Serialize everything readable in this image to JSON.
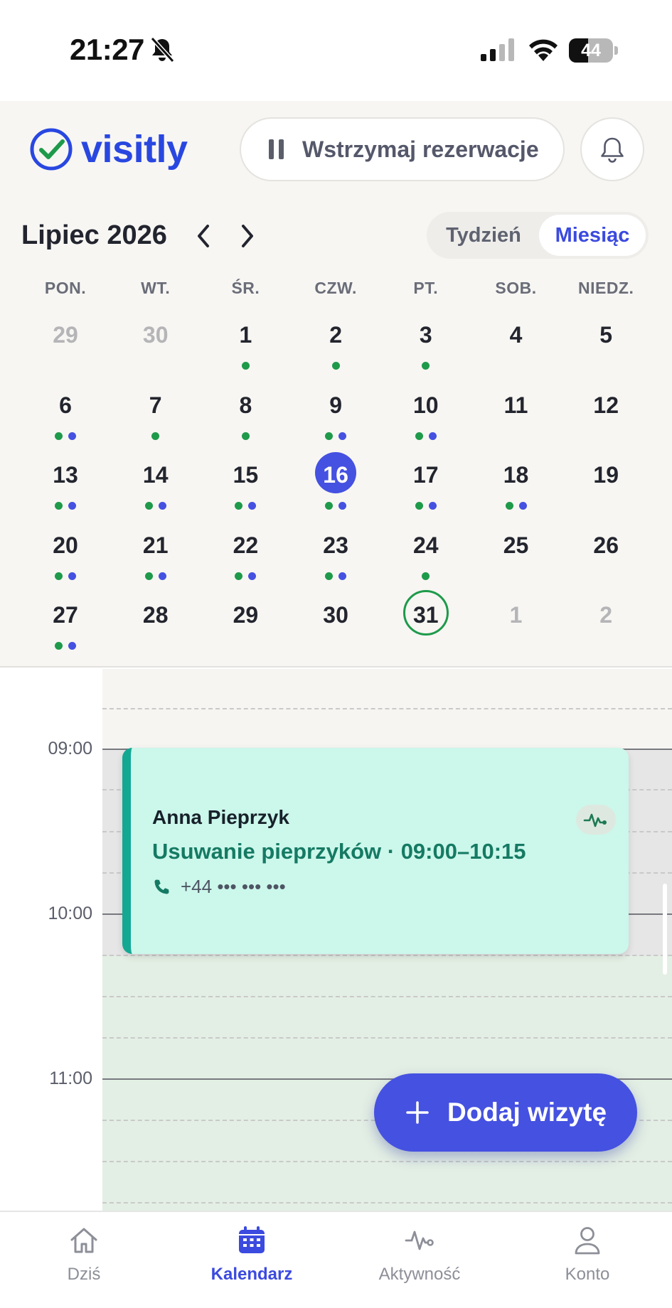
{
  "status_bar": {
    "time": "21:27",
    "battery_level": "44",
    "battery_fraction": 0.44
  },
  "header": {
    "brand": "visitly",
    "pause_button_label": "Wstrzymaj rezerwacje"
  },
  "calendar": {
    "month_title": "Lipiec 2026",
    "view_toggle": {
      "week": "Tydzień",
      "month": "Miesiąc",
      "selected": "month"
    },
    "weekdays": [
      "PON.",
      "WT.",
      "ŚR.",
      "CZW.",
      "PT.",
      "SOB.",
      "NIEDZ."
    ],
    "weeks": [
      [
        {
          "d": "29",
          "other": true,
          "dots": []
        },
        {
          "d": "30",
          "other": true,
          "dots": []
        },
        {
          "d": "1",
          "dots": [
            "green"
          ]
        },
        {
          "d": "2",
          "dots": [
            "green"
          ]
        },
        {
          "d": "3",
          "dots": [
            "green"
          ]
        },
        {
          "d": "4",
          "dots": []
        },
        {
          "d": "5",
          "dots": []
        }
      ],
      [
        {
          "d": "6",
          "dots": [
            "green",
            "blue"
          ]
        },
        {
          "d": "7",
          "dots": [
            "green"
          ]
        },
        {
          "d": "8",
          "dots": [
            "green"
          ]
        },
        {
          "d": "9",
          "dots": [
            "green",
            "blue"
          ]
        },
        {
          "d": "10",
          "dots": [
            "green",
            "blue"
          ]
        },
        {
          "d": "11",
          "dots": []
        },
        {
          "d": "12",
          "dots": []
        }
      ],
      [
        {
          "d": "13",
          "dots": [
            "green",
            "blue"
          ]
        },
        {
          "d": "14",
          "dots": [
            "green",
            "blue"
          ]
        },
        {
          "d": "15",
          "dots": [
            "green",
            "blue"
          ]
        },
        {
          "d": "16",
          "selected": true,
          "dots": [
            "green",
            "blue"
          ]
        },
        {
          "d": "17",
          "dots": [
            "green",
            "blue"
          ]
        },
        {
          "d": "18",
          "dots": [
            "green",
            "blue"
          ]
        },
        {
          "d": "19",
          "dots": []
        }
      ],
      [
        {
          "d": "20",
          "dots": [
            "green",
            "blue"
          ]
        },
        {
          "d": "21",
          "dots": [
            "green",
            "blue"
          ]
        },
        {
          "d": "22",
          "dots": [
            "green",
            "blue"
          ]
        },
        {
          "d": "23",
          "dots": [
            "green",
            "blue"
          ]
        },
        {
          "d": "24",
          "dots": [
            "green"
          ]
        },
        {
          "d": "25",
          "dots": []
        },
        {
          "d": "26",
          "dots": []
        }
      ],
      [
        {
          "d": "27",
          "dots": [
            "green",
            "blue"
          ]
        },
        {
          "d": "28",
          "dots": []
        },
        {
          "d": "29",
          "dots": []
        },
        {
          "d": "30",
          "dots": []
        },
        {
          "d": "31",
          "today": true,
          "dots": []
        },
        {
          "d": "1",
          "other": true,
          "dots": []
        },
        {
          "d": "2",
          "other": true,
          "dots": []
        }
      ]
    ]
  },
  "timeline": {
    "hours": [
      "09:00",
      "10:00",
      "11:00"
    ],
    "appointment": {
      "client_name": "Anna Pieprzyk",
      "service_line": "Usuwanie pieprzyków · 09:00–10:15",
      "phone": "+44 ••• ••• •••",
      "badge_icon": "activity-icon"
    }
  },
  "fab": {
    "label": "Dodaj wizytę",
    "icon": "plus-icon"
  },
  "tabbar": {
    "tabs": [
      {
        "label": "Dziś",
        "icon": "home-icon"
      },
      {
        "label": "Kalendarz",
        "icon": "calendar-icon",
        "active": true
      },
      {
        "label": "Aktywność",
        "icon": "activity-icon"
      },
      {
        "label": "Konto",
        "icon": "user-icon"
      }
    ]
  },
  "colors": {
    "accent": "#4551e0",
    "brand": "#2947e0",
    "green_dot": "#1e9a4a",
    "blue_dot": "#4551e0",
    "appointment_bg": "#ccf7eb",
    "appointment_border": "#14a893"
  }
}
